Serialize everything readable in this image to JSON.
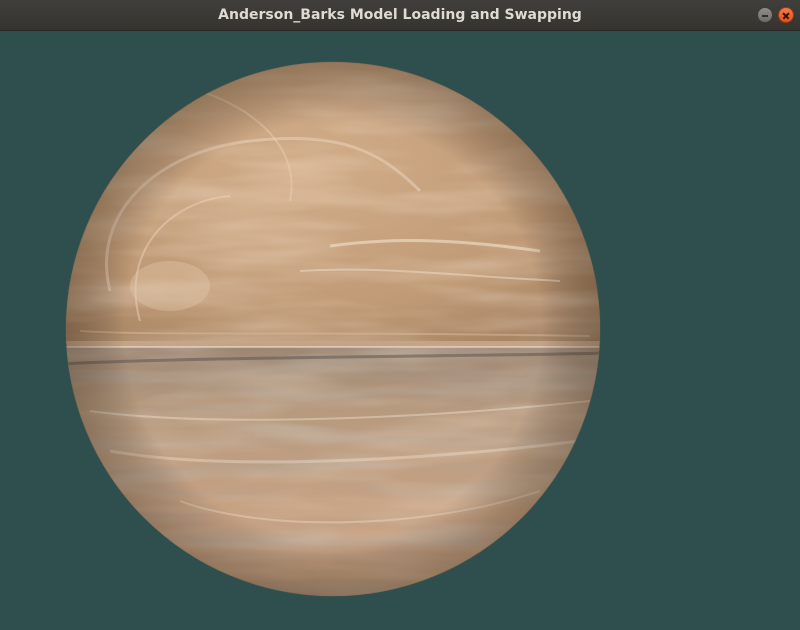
{
  "window": {
    "title": "Anderson_Barks Model Loading and Swapping",
    "buttons": {
      "minimize": "minimize-icon",
      "close": "close-icon"
    }
  },
  "viewport": {
    "background": "#2f4f4f",
    "model": "textured-sphere",
    "texture_palette": [
      "#c8a27e",
      "#a98565",
      "#e6cdb3",
      "#7d6a5c"
    ]
  }
}
